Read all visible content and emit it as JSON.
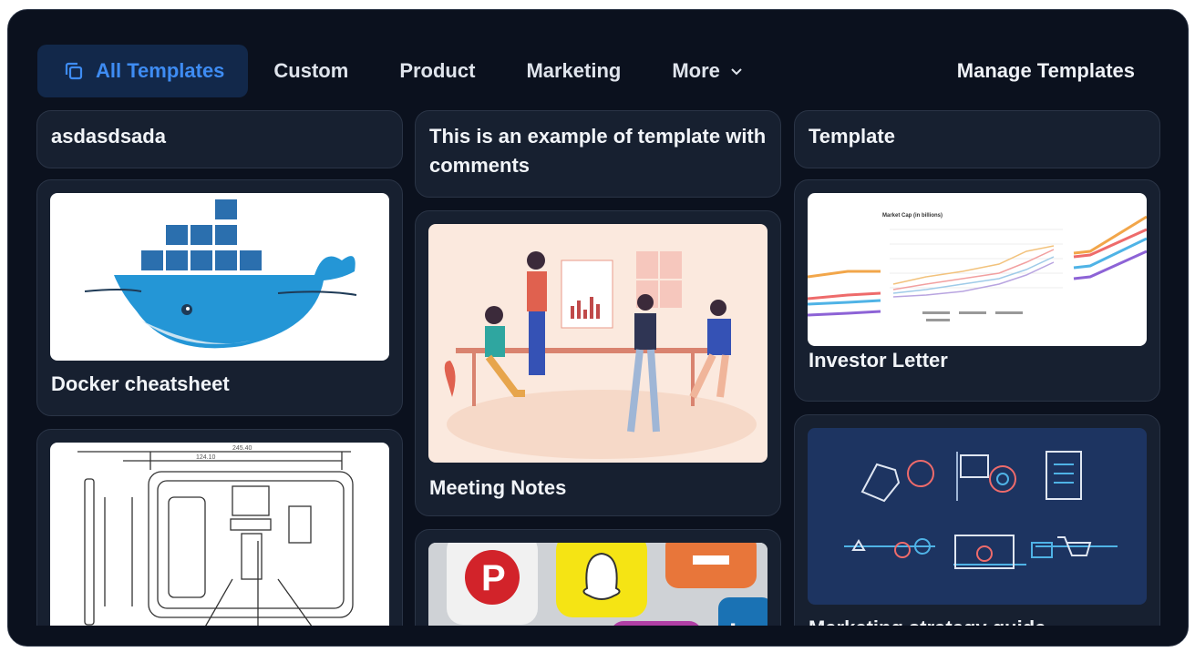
{
  "tabs": {
    "all": "All Templates",
    "custom": "Custom",
    "product": "Product",
    "marketing": "Marketing",
    "more": "More"
  },
  "manage_label": "Manage Templates",
  "columns": {
    "c1": {
      "header": "asdasdsada",
      "card1": "Docker cheatsheet"
    },
    "c2": {
      "header": "This is an example of template with comments",
      "card1": "Meeting Notes"
    },
    "c3": {
      "header": "Template",
      "card1": "Investor Letter",
      "card2": "Marketing strategy guide"
    }
  },
  "chart_thumb": {
    "title": "Market Cap (in billions)"
  },
  "colors": {
    "accent": "#3e8cf3",
    "bg": "#0b111e",
    "card": "#172030"
  }
}
